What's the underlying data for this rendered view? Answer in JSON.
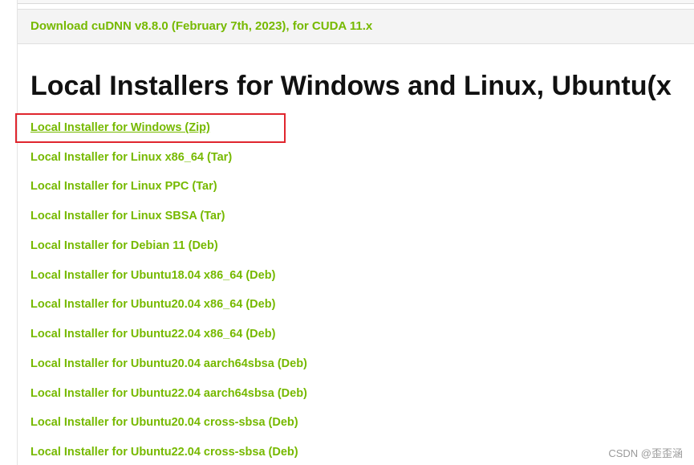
{
  "section": {
    "download_link": "Download cuDNN v8.8.0 (February 7th, 2023), for CUDA 11.x"
  },
  "heading": "Local Installers for Windows and Linux, Ubuntu(x",
  "installers": [
    "Local Installer for Windows (Zip)",
    "Local Installer for Linux x86_64 (Tar)",
    "Local Installer for Linux PPC (Tar)",
    "Local Installer for Linux SBSA (Tar)",
    "Local Installer for Debian 11 (Deb)",
    "Local Installer for Ubuntu18.04 x86_64 (Deb)",
    "Local Installer for Ubuntu20.04 x86_64 (Deb)",
    "Local Installer for Ubuntu22.04 x86_64 (Deb)",
    "Local Installer for Ubuntu20.04 aarch64sbsa (Deb)",
    "Local Installer for Ubuntu22.04 aarch64sbsa (Deb)",
    "Local Installer for Ubuntu20.04 cross-sbsa (Deb)",
    "Local Installer for Ubuntu22.04 cross-sbsa (Deb)"
  ],
  "watermark": "CSDN @歪歪涵",
  "colors": {
    "link": "#76b900",
    "highlight": "#e0262e",
    "heading": "#111111"
  }
}
